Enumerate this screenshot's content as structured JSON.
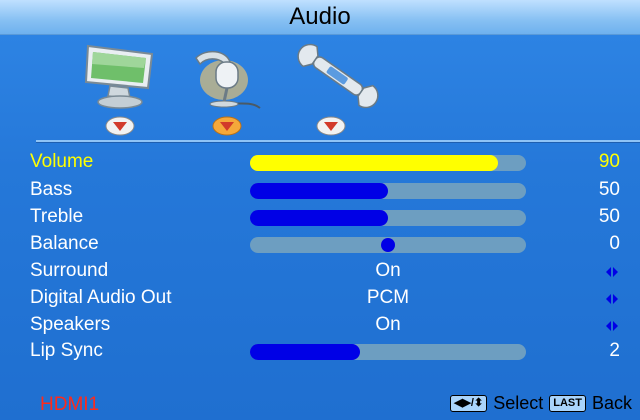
{
  "title": "Audio",
  "tabs": [
    {
      "name": "picture",
      "icon": "monitor-icon",
      "selected": false
    },
    {
      "name": "audio",
      "icon": "microphone-icon",
      "selected": true
    },
    {
      "name": "setup",
      "icon": "wrench-icon",
      "selected": false
    }
  ],
  "menu": [
    {
      "label": "Volume",
      "value": "90",
      "type": "slider",
      "level": 0.9,
      "selected": true
    },
    {
      "label": "Bass",
      "value": "50",
      "type": "slider",
      "level": 0.5
    },
    {
      "label": "Treble",
      "value": "50",
      "type": "slider",
      "level": 0.5
    },
    {
      "label": "Balance",
      "value": "0",
      "type": "balance",
      "level": 0
    },
    {
      "label": "Surround",
      "option": "On",
      "type": "option"
    },
    {
      "label": "Digital Audio Out",
      "option": "PCM",
      "type": "option"
    },
    {
      "label": "Speakers",
      "option": "On",
      "type": "option"
    },
    {
      "label": "Lip Sync",
      "value": "2",
      "type": "slider",
      "level": 0.4
    }
  ],
  "status": {
    "source": "HDMI1",
    "select_key_icon": "dpad-icon",
    "select_label": "Select",
    "back_key": "LAST",
    "back_label": "Back"
  },
  "colors": {
    "selected_text": "#ffff00",
    "source_text": "#ff2a1a",
    "slider_fill": "#0000e6",
    "slider_track": "#6d9ec1"
  }
}
